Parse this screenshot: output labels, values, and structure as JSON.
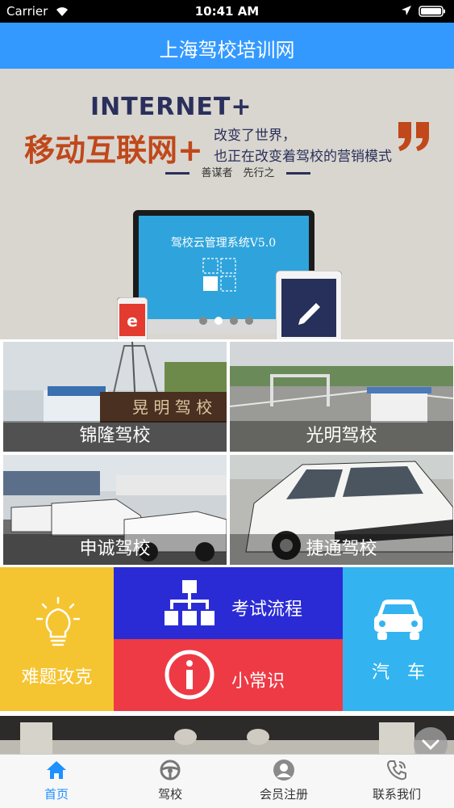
{
  "status_bar": {
    "carrier": "Carrier",
    "time": "10:41 AM"
  },
  "nav": {
    "title": "上海驾校培训网"
  },
  "banner": {
    "headline_en": "INTERNET+",
    "headline_cn": "移动互联网+",
    "line1": "改变了世界，",
    "line2": "也正在改变着驾校的营销模式",
    "slogan": "善谋者　先行之",
    "system_title": "驾校云管理系统V5.0",
    "slide_count": 4,
    "active_slide": 2
  },
  "schools": [
    {
      "name": "锦隆驾校"
    },
    {
      "name": "光明驾校"
    },
    {
      "name": "申诚驾校"
    },
    {
      "name": "捷通驾校"
    }
  ],
  "features": {
    "difficult": {
      "label": "难题攻克",
      "color": "#f5c431",
      "icon": "lightbulb-icon"
    },
    "exam_process": {
      "label": "考试流程",
      "color": "#2b2bd6",
      "icon": "flowchart-icon"
    },
    "tips": {
      "label": "小常识",
      "color": "#ee3a45",
      "icon": "info-icon"
    },
    "car": {
      "label": "汽　车",
      "color": "#33b4f0",
      "icon": "car-icon"
    }
  },
  "tabs": [
    {
      "label": "首页",
      "icon": "home-icon",
      "active": true
    },
    {
      "label": "驾校",
      "icon": "steering-wheel-icon",
      "active": false
    },
    {
      "label": "会员注册",
      "icon": "user-icon",
      "active": false
    },
    {
      "label": "联系我们",
      "icon": "phone-icon",
      "active": false
    }
  ],
  "colors": {
    "nav_bg": "#3399ff",
    "tab_active": "#1e90ff"
  }
}
